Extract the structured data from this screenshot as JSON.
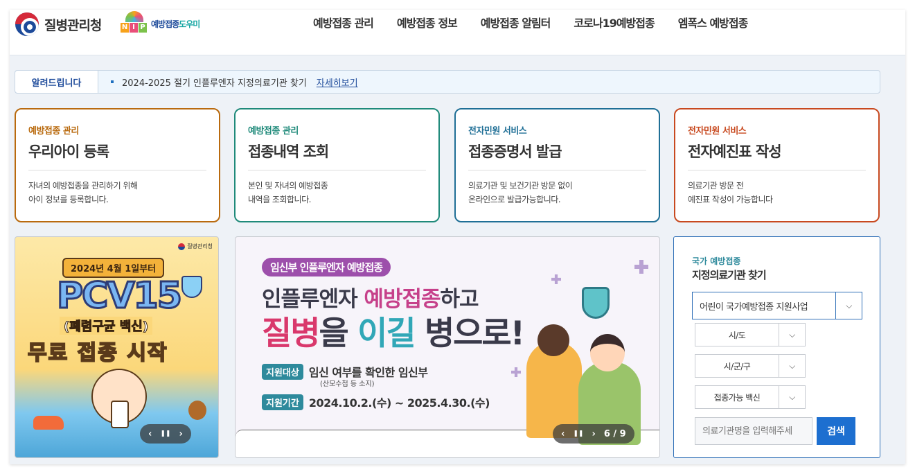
{
  "header": {
    "agency_name": "질병관리청",
    "nip_letters": [
      "N",
      "I",
      "P"
    ],
    "nip_name_a": "예방접종",
    "nip_name_b": "도우미",
    "nav": [
      "예방접종 관리",
      "예방접종 정보",
      "예방접종 알림터",
      "코로나19예방접종",
      "엠폭스 예방접종"
    ]
  },
  "notice": {
    "tag": "알려드립니다",
    "message": "2024-2025 절기 인플루엔자 지정의료기관 찾기",
    "link": "자세히보기"
  },
  "cards": [
    {
      "category": "예방접종 관리",
      "title": "우리아이 등록",
      "desc1": "자녀의 예방접종을 관리하기 위해",
      "desc2": "아이 정보를 등록합니다.",
      "color": "#b96a0e"
    },
    {
      "category": "예방접종 관리",
      "title": "접종내역 조회",
      "desc1": "본인 및 자녀의 예방접종",
      "desc2": "내역을 조회합니다.",
      "color": "#1f8a7a"
    },
    {
      "category": "전자민원 서비스",
      "title": "접종증명서 발급",
      "desc1": "의료기관 및 보건기관 방문 없이",
      "desc2": "온라인으로 발급가능합니다.",
      "color": "#1f6f96"
    },
    {
      "category": "전자민원 서비스",
      "title": "전자예진표 작성",
      "desc1": "의료기관 방문 전",
      "desc2": "예진표 작성이 가능합니다",
      "color": "#c8491f"
    }
  ],
  "banner_left": {
    "agency": "질병관리청",
    "date": "2024년 4월 1일부터",
    "headline": "PCV15",
    "subline": "(폐렴구균 백신)",
    "free_a": "무료 접종",
    "free_b": "시작",
    "controls": {
      "prev": "‹",
      "pause": "❚❚",
      "next": "›"
    }
  },
  "banner_main": {
    "pill": "임신부 인플루엔자 예방접종",
    "line1_a": "인플루엔자 ",
    "line1_b": "예방접종",
    "line1_c": "하고",
    "line2_a": "질병",
    "line2_b": "을 ",
    "line2_c": "이길",
    "line2_d": " 병으로!",
    "target_label": "지원대상",
    "target_value": "임신 여부를 확인한 임신부",
    "target_note": "(산모수첩 등 소지)",
    "period_label": "지원기간",
    "period_value": "2024.10.2.(수) ~ 2025.4.30.(수)",
    "controls": {
      "prev": "‹",
      "pause": "❚❚",
      "next": "›",
      "page": "6 / 9"
    }
  },
  "finder": {
    "category": "국가 예방접종",
    "title": "지정의료기관 찾기",
    "program": "어린이 국가예방접종 지원사업",
    "sido": "시/도",
    "sigungu": "시/군/구",
    "vaccine": "접종가능 백신",
    "placeholder": "의료기관명을 입력해주세",
    "search_label": "검색",
    "arrow": "⌵"
  }
}
